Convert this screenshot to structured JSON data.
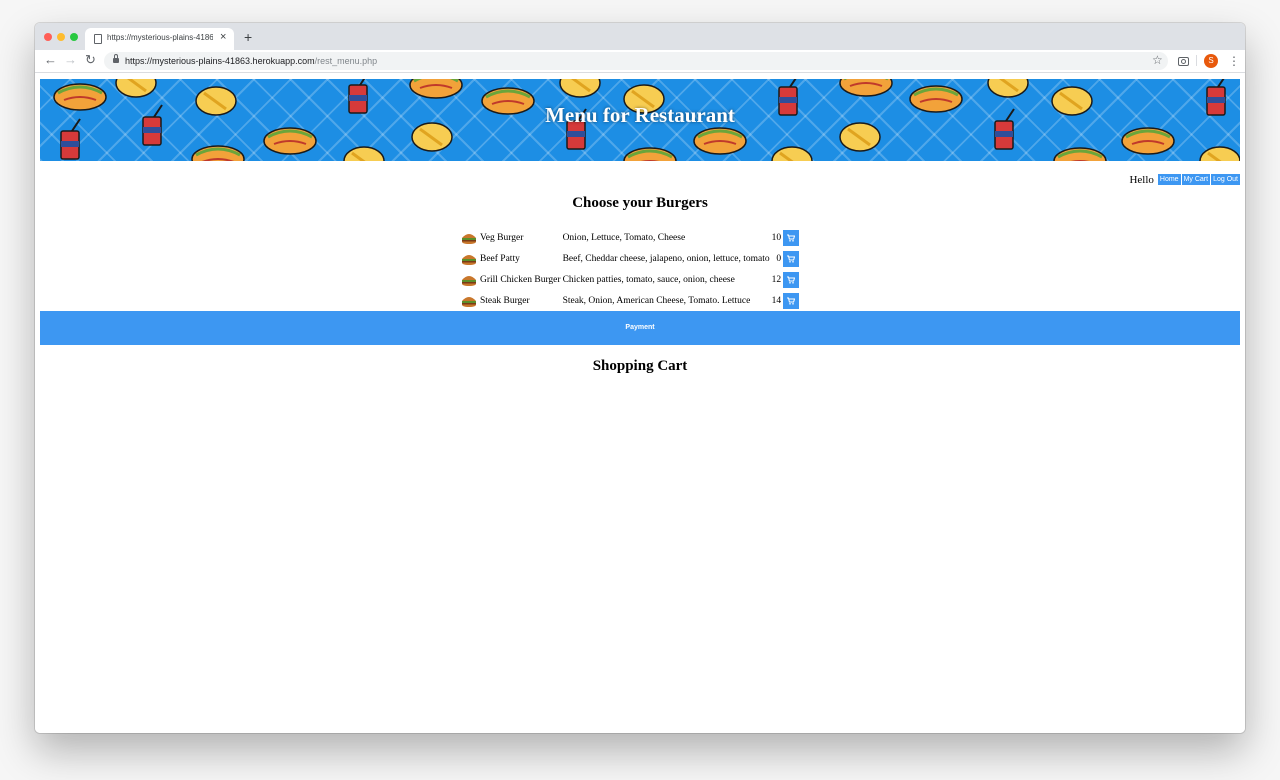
{
  "browser": {
    "tab_title": "https://mysterious-plains-41863.herokuapp.com/rest_menu.php",
    "tab_close": "×",
    "new_tab": "+",
    "url_main": "https://mysterious-plains-41863.herokuapp.com",
    "url_path": "/rest_menu.php",
    "profile_initial": "S"
  },
  "banner": {
    "title": "Menu for Restaurant"
  },
  "header": {
    "greeting": "Hello",
    "buttons": [
      "Home",
      "My Cart",
      "Log Out"
    ]
  },
  "menu": {
    "title": "Choose your Burgers",
    "items": [
      {
        "name": "Veg Burger",
        "ingredients": "Onion, Lettuce, Tomato, Cheese",
        "price": "10"
      },
      {
        "name": "Beef Patty",
        "ingredients": "Beef, Cheddar cheese, jalapeno, onion, lettuce, tomato",
        "price": "0"
      },
      {
        "name": "Grill Chicken Burger",
        "ingredients": "Chicken patties, tomato, sauce, onion, cheese",
        "price": "12"
      },
      {
        "name": "Steak Burger",
        "ingredients": "Steak, Onion, American Cheese, Tomato. Lettuce",
        "price": "14"
      }
    ]
  },
  "payment": {
    "label": "Payment"
  },
  "cart": {
    "title": "Shopping Cart"
  },
  "colors": {
    "accent": "#3d97f2",
    "banner": "#1d8ee4"
  },
  "icons": {
    "back": "←",
    "forward": "→",
    "reload": "↻",
    "star": "☆",
    "menu": "⋮",
    "item_icon": "burger-icon",
    "add_icon": "cart-icon"
  }
}
